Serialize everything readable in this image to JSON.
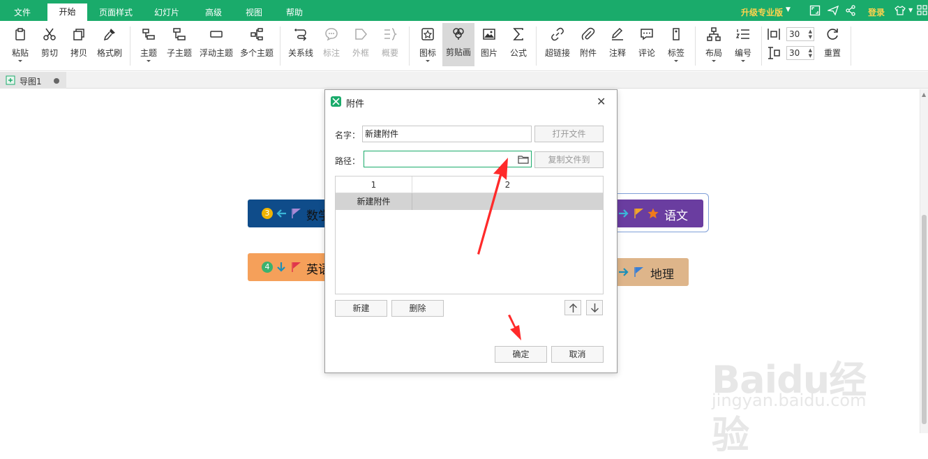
{
  "menu": {
    "tabs": [
      {
        "label": "文件"
      },
      {
        "label": "开始"
      },
      {
        "label": "页面样式"
      },
      {
        "label": "幻灯片"
      },
      {
        "label": "高级"
      },
      {
        "label": "视图"
      },
      {
        "label": "帮助"
      }
    ],
    "active_tab": "开始",
    "upgrade_label": "升级专业版",
    "login_label": "登录"
  },
  "ribbon": {
    "tools": [
      {
        "label": "粘贴",
        "icon": "paste-icon"
      },
      {
        "label": "剪切",
        "icon": "scissors-icon"
      },
      {
        "label": "拷贝",
        "icon": "copy-icon"
      },
      {
        "label": "格式刷",
        "icon": "format-brush-icon"
      },
      {
        "label": "主题",
        "icon": "topic-icon"
      },
      {
        "label": "子主题",
        "icon": "subtopic-icon"
      },
      {
        "label": "浮动主题",
        "icon": "floating-topic-icon"
      },
      {
        "label": "多个主题",
        "icon": "multi-topic-icon"
      },
      {
        "label": "关系线",
        "icon": "relation-line-icon"
      },
      {
        "label": "标注",
        "icon": "callout-icon"
      },
      {
        "label": "外框",
        "icon": "boundary-icon"
      },
      {
        "label": "概要",
        "icon": "summary-icon"
      },
      {
        "label": "图标",
        "icon": "icon-library-icon"
      },
      {
        "label": "剪贴画",
        "icon": "clipart-icon"
      },
      {
        "label": "图片",
        "icon": "image-icon"
      },
      {
        "label": "公式",
        "icon": "formula-icon"
      },
      {
        "label": "超链接",
        "icon": "hyperlink-icon"
      },
      {
        "label": "附件",
        "icon": "attachment-icon"
      },
      {
        "label": "注释",
        "icon": "note-icon"
      },
      {
        "label": "评论",
        "icon": "comment-icon"
      },
      {
        "label": "标签",
        "icon": "tag-icon"
      },
      {
        "label": "布局",
        "icon": "layout-icon"
      },
      {
        "label": "编号",
        "icon": "numbering-icon"
      },
      {
        "label": "重置",
        "icon": "reset-icon"
      }
    ],
    "spacing_h": "30",
    "spacing_v": "30"
  },
  "document": {
    "tab_label": "导图1"
  },
  "canvas": {
    "topics": [
      {
        "label": "数学",
        "number": "3"
      },
      {
        "label": "英语",
        "number": "4"
      },
      {
        "label": "语文"
      },
      {
        "label": "地理"
      }
    ]
  },
  "dialog": {
    "title": "附件",
    "name_label": "名字：",
    "name_value": "新建附件",
    "open_file_label": "打开文件",
    "path_label": "路径：",
    "path_value": "",
    "copy_file_label": "复制文件到",
    "grid_headers": [
      "1",
      "2"
    ],
    "grid_rows": [
      {
        "c1": "新建附件",
        "c2": ""
      }
    ],
    "new_label": "新建",
    "delete_label": "删除",
    "ok_label": "确定",
    "cancel_label": "取消"
  },
  "watermark": {
    "brand": "Baidu经验",
    "sub": "jingyan.baidu.com"
  },
  "colors": {
    "accent": "#1aab6b",
    "upgrade": "#ffd34d",
    "annotation_arrow": "#ff2a2a"
  }
}
